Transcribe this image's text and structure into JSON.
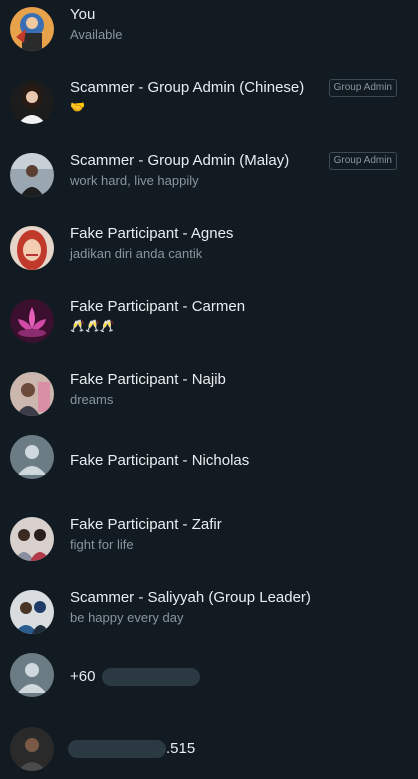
{
  "participants": [
    {
      "name": "You",
      "status": "Available",
      "badge": "",
      "avatar": "avatar-you"
    },
    {
      "name": "Scammer - Group Admin (Chinese)",
      "status": "🤝",
      "badge": "Group Admin",
      "avatar": "avatar-woman"
    },
    {
      "name": "Scammer - Group Admin (Malay)",
      "status": "work hard, live happily",
      "badge": "Group Admin",
      "avatar": "avatar-man"
    },
    {
      "name": "Fake Participant - Agnes",
      "status": "jadikan diri anda cantik",
      "badge": "",
      "avatar": "avatar-hijab"
    },
    {
      "name": "Fake Participant - Carmen",
      "status": "🥂🥂🥂",
      "badge": "",
      "avatar": "avatar-lotus"
    },
    {
      "name": "Fake Participant - Najib",
      "status": "dreams",
      "badge": "",
      "avatar": "avatar-photo"
    },
    {
      "name": "Fake Participant - Nicholas",
      "status": "",
      "badge": "",
      "avatar": "avatar-default"
    },
    {
      "name": "Fake Participant - Zafir",
      "status": "fight for life",
      "badge": "",
      "avatar": "avatar-photo2"
    },
    {
      "name": "Scammer - Saliyyah (Group Leader)",
      "status": "be happy every day",
      "badge": "",
      "avatar": "avatar-woman2"
    },
    {
      "name": "+60",
      "status": "",
      "badge": "",
      "avatar": "avatar-default"
    },
    {
      "name": ".515",
      "status": "",
      "badge": "",
      "avatar": "avatar-photo3"
    }
  ],
  "colors": {
    "background": "#121b22",
    "primary_text": "#e9edef",
    "secondary_text": "#8696a0",
    "default_avatar_bg": "#6b7c85"
  }
}
